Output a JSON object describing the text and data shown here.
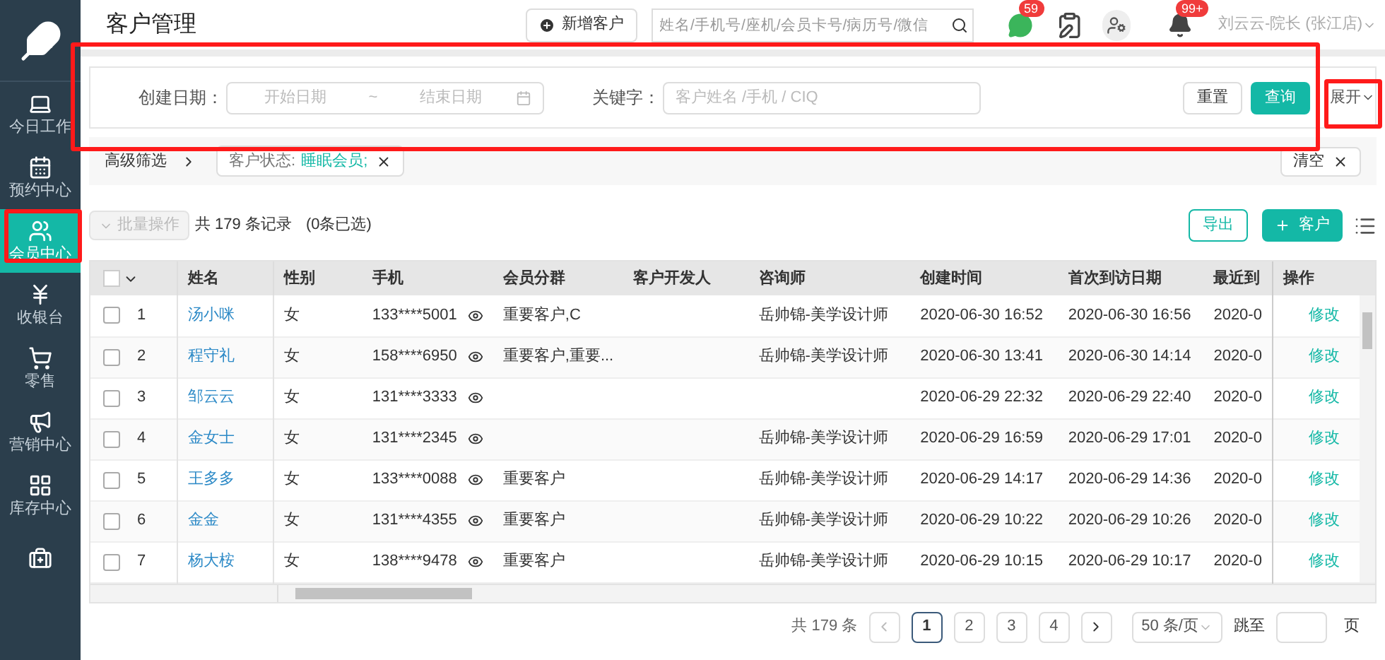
{
  "sidebar": {
    "items": [
      {
        "label": "今日工作",
        "selected": false
      },
      {
        "label": "预约中心",
        "selected": false
      },
      {
        "label": "会员中心",
        "selected": true
      },
      {
        "label": "收银台",
        "selected": false
      },
      {
        "label": "零售",
        "selected": false
      },
      {
        "label": "营销中心",
        "selected": false
      },
      {
        "label": "库存中心",
        "selected": false
      },
      {
        "selected": false
      }
    ]
  },
  "header": {
    "title": "客户管理",
    "add_button": "新增客户",
    "search": {
      "placeholder": "姓名/手机号/座机/会员卡号/病历号/微信"
    },
    "chat_badge": "59",
    "bell_badge": "99+",
    "user": "刘云云-院长 (张江店)"
  },
  "filter": {
    "date_label": "创建日期：",
    "start_placeholder": "开始日期",
    "separator": "~",
    "end_placeholder": "结束日期",
    "keyword_label": "关键字：",
    "keyword_placeholder": "客户姓名 /手机 / CIQ",
    "reset": "重置",
    "query": "查询",
    "expand": "展开"
  },
  "advanced": {
    "label": "高级筛选",
    "tag_label": "客户状态:",
    "tag_value": "睡眠会员;",
    "clear": "清空"
  },
  "toolbar": {
    "batch": "批量操作",
    "total": "共 179 条记录",
    "selected_count": "(0条已选)",
    "export": "导出",
    "add": "客户"
  },
  "table": {
    "all_checked": false,
    "columns": [
      "姓名",
      "性别",
      "手机",
      "会员分群",
      "客户开发人",
      "咨询师",
      "创建时间",
      "首次到访日期",
      "最近到",
      "操作"
    ],
    "rows": [
      {
        "checked": false,
        "index": "1",
        "name": "汤小咪",
        "gender": "女",
        "phone": "133****5001",
        "group": "重要客户,C",
        "developer": "",
        "consultant": "岳帅锦-美学设计师",
        "created": "2020-06-30 16:52",
        "first_visit": "2020-06-30 16:56",
        "recent": "2020-0",
        "action": "修改"
      },
      {
        "checked": false,
        "index": "2",
        "name": "程守礼",
        "gender": "女",
        "phone": "158****6950",
        "group": "重要客户,重要...",
        "developer": "",
        "consultant": "岳帅锦-美学设计师",
        "created": "2020-06-30 13:41",
        "first_visit": "2020-06-30 14:14",
        "recent": "2020-0",
        "action": "修改"
      },
      {
        "checked": false,
        "index": "3",
        "name": "邹云云",
        "gender": "女",
        "phone": "131****3333",
        "group": "",
        "developer": "",
        "consultant": "",
        "created": "2020-06-29 22:32",
        "first_visit": "2020-06-29 22:40",
        "recent": "2020-0",
        "action": "修改"
      },
      {
        "checked": false,
        "index": "4",
        "name": "金女士",
        "gender": "女",
        "phone": "131****2345",
        "group": "",
        "developer": "",
        "consultant": "岳帅锦-美学设计师",
        "created": "2020-06-29 16:59",
        "first_visit": "2020-06-29 17:01",
        "recent": "2020-0",
        "action": "修改"
      },
      {
        "checked": false,
        "index": "5",
        "name": "王多多",
        "gender": "女",
        "phone": "133****0088",
        "group": "重要客户",
        "developer": "",
        "consultant": "岳帅锦-美学设计师",
        "created": "2020-06-29 14:17",
        "first_visit": "2020-06-29 14:36",
        "recent": "2020-0",
        "action": "修改"
      },
      {
        "checked": false,
        "index": "6",
        "name": "金金",
        "gender": "女",
        "phone": "131****4355",
        "group": "重要客户",
        "developer": "",
        "consultant": "岳帅锦-美学设计师",
        "created": "2020-06-29 10:22",
        "first_visit": "2020-06-29 10:26",
        "recent": "2020-0",
        "action": "修改"
      },
      {
        "checked": false,
        "index": "7",
        "name": "杨大桉",
        "gender": "女",
        "phone": "138****9478",
        "group": "重要客户",
        "developer": "",
        "consultant": "岳帅锦-美学设计师",
        "created": "2020-06-29 10:15",
        "first_visit": "2020-06-29 10:17",
        "recent": "2020-0",
        "action": "修改"
      }
    ]
  },
  "pagination": {
    "total": "共 179 条",
    "pages": [
      {
        "label": "1",
        "selected": true
      },
      {
        "label": "2",
        "selected": false
      },
      {
        "label": "3",
        "selected": false
      },
      {
        "label": "4",
        "selected": false
      }
    ],
    "page_size": "50 条/页",
    "jump_label": "跳至",
    "page_unit": "页"
  }
}
